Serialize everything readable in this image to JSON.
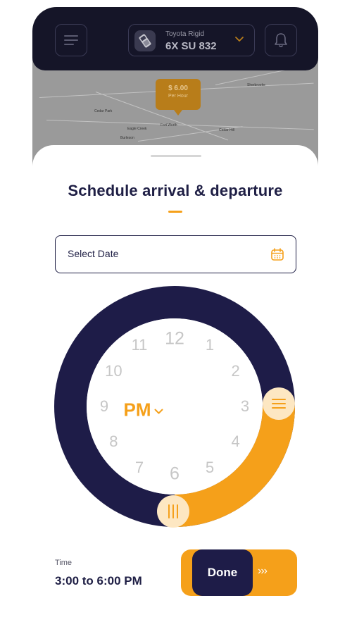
{
  "header": {
    "vehicle_model": "Toyota Rigid",
    "vehicle_plate": "6X SU 832"
  },
  "map": {
    "price_value": "$ 6.00",
    "price_unit": "Per Hour",
    "place_labels": [
      "Sherbrooke",
      "Fort Worth",
      "Eagle Creek",
      "Cedar Hill",
      "Cedar Park",
      "Burleson"
    ]
  },
  "sheet": {
    "title": "Schedule arrival & departure",
    "date_placeholder": "Select Date",
    "clock_numbers": [
      "12",
      "1",
      "2",
      "3",
      "4",
      "5",
      "6",
      "7",
      "8",
      "9",
      "10",
      "11"
    ],
    "period": "PM",
    "time_label": "Time",
    "time_value": "3:00 to 6:00 PM",
    "done_label": "Done",
    "done_arrows": "›››"
  },
  "colors": {
    "navy": "#1e1c48",
    "accent": "#f5a01a",
    "handle": "#fde7c2",
    "numbers": "#c6c6c6"
  }
}
